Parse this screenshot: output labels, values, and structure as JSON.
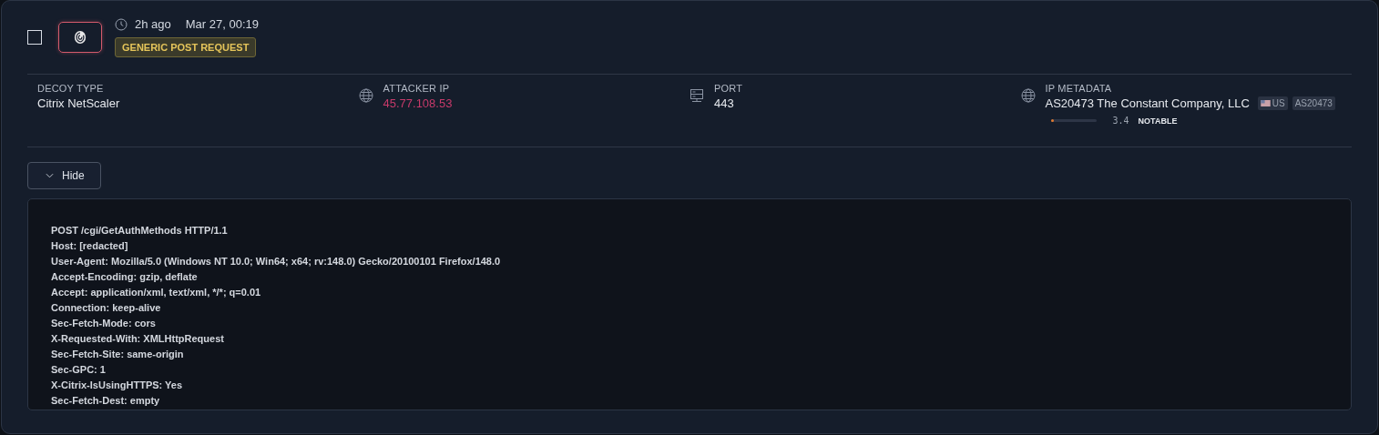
{
  "event": {
    "selected": false,
    "relative_time": "2h ago",
    "timestamp": "Mar 27, 00:19",
    "tag": "GENERIC POST REQUEST"
  },
  "fields": [
    {
      "kind": "plain",
      "label": "DECOY TYPE",
      "value": "Citrix NetScaler"
    },
    {
      "kind": "ip",
      "label": "ATTACKER IP",
      "value": "45.77.108.53"
    },
    {
      "kind": "port",
      "label": "PORT",
      "value": "443"
    },
    {
      "kind": "metadata",
      "label": "IP METADATA",
      "value": "AS20473 The Constant Company, LLC",
      "country": "US",
      "asn": "AS20473",
      "score": {
        "level": 0.04,
        "reading": "3.4",
        "rating": "NOTABLE"
      }
    }
  ],
  "toggle": {
    "label": "Hide",
    "expanded": true
  },
  "request_lines": [
    "POST /cgi/GetAuthMethods HTTP/1.1",
    "Host: [redacted]",
    "User-Agent: Mozilla/5.0 (Windows NT 10.0; Win64; x64; rv:148.0) Gecko/20100101 Firefox/148.0",
    "Accept-Encoding: gzip, deflate",
    "Accept: application/xml, text/xml, */*; q=0.01",
    "Connection: keep-alive",
    "Sec-Fetch-Mode: cors",
    "X-Requested-With: XMLHttpRequest",
    "Sec-Fetch-Site: same-origin",
    "Sec-GPC: 1",
    "X-Citrix-IsUsingHTTPS: Yes",
    "Sec-Fetch-Dest: empty"
  ]
}
